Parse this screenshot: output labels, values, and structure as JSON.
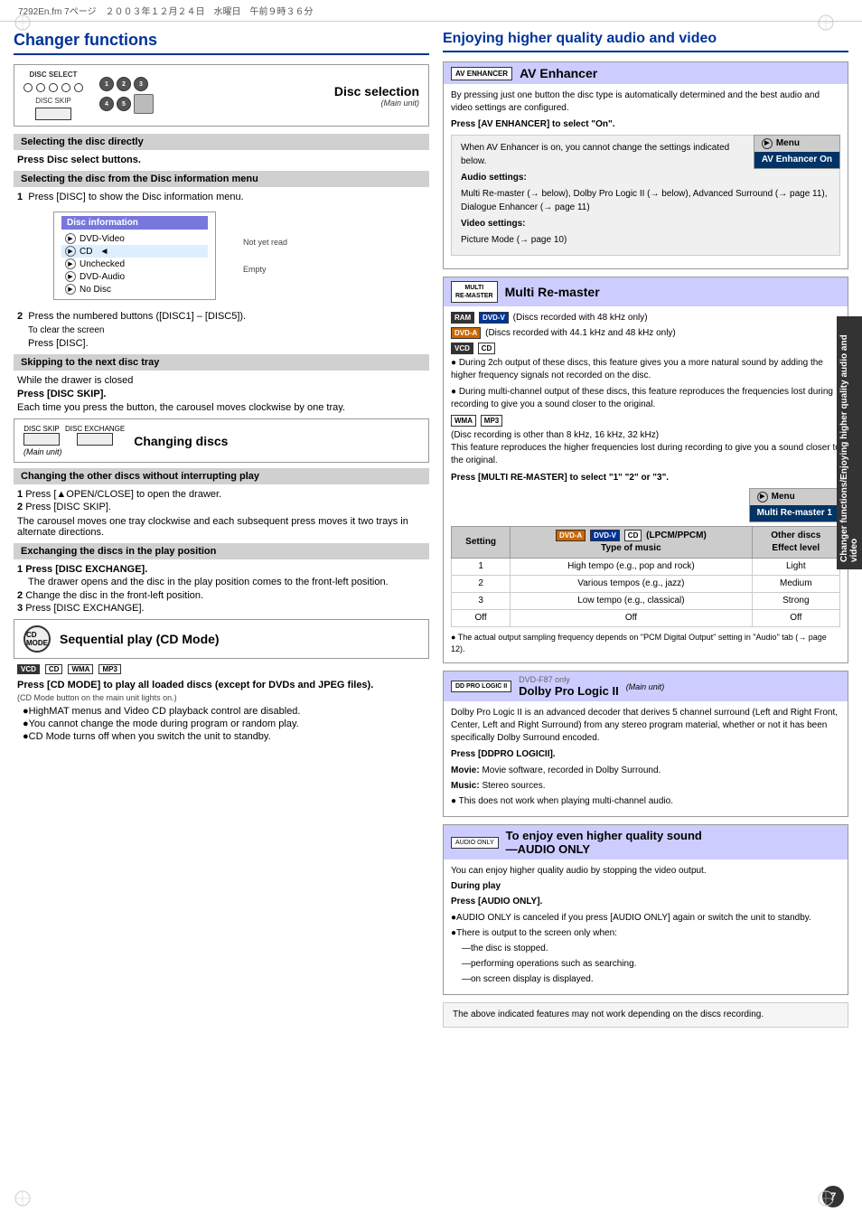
{
  "header": {
    "file_info": "7292En.fm 7ページ　２００３年１２月２４日　水曜日　午前９時３６分"
  },
  "left": {
    "section_title": "Changer functions",
    "disc_selection": {
      "title": "Disc selection",
      "main_unit": "(Main unit)",
      "disc_select_label": "DISC SELECT",
      "disc_skip_label": "DISC SKIP"
    },
    "selecting_disc_directly": {
      "header": "Selecting the disc directly",
      "instruction": "Press Disc select buttons."
    },
    "selecting_from_menu": {
      "header": "Selecting the disc from the Disc information menu",
      "step1": "Press [DISC] to show the Disc information menu.",
      "disc_info_title": "Disc information",
      "disc_items": [
        {
          "label": "DVD-Video",
          "note": ""
        },
        {
          "label": "CD",
          "note": ""
        },
        {
          "label": "Unchecked",
          "note": "Not yet read"
        },
        {
          "label": "DVD-Audio",
          "note": ""
        },
        {
          "label": "No Disc",
          "note": "Empty"
        }
      ],
      "step2": "Press the numbered buttons ([DISC1] – [DISC5]).",
      "clear_screen": "To clear the screen",
      "clear_press": "Press [DISC]."
    },
    "skipping_next": {
      "header": "Skipping to the next disc tray",
      "while_closed": "While the drawer is closed",
      "press": "Press [DISC SKIP].",
      "description": "Each time you press the button, the carousel moves clockwise by one tray."
    },
    "changing_discs": {
      "title": "Changing discs",
      "main_unit": "(Main unit)",
      "disc_skip_label": "DISC SKIP",
      "disc_exchange_label": "DISC EXCHANGE",
      "header": "Changing the other discs without interrupting play",
      "step1": "Press [▲OPEN/CLOSE] to open the drawer.",
      "step2": "Press [DISC SKIP].",
      "description": "The carousel moves one tray clockwise and each subsequent press moves it two trays in alternate directions."
    },
    "exchanging_discs": {
      "header": "Exchanging the discs in the play position",
      "step1_label": "Press [DISC EXCHANGE].",
      "step1_desc": "The drawer opens and the disc in the play position comes to the front-left position.",
      "step2": "Change the disc in the front-left position.",
      "step3": "Press [DISC EXCHANGE]."
    },
    "sequential_play": {
      "title": "Sequential play (CD Mode)",
      "badges": [
        "VCD",
        "CD",
        "WMA",
        "MP3"
      ],
      "press_instruction": "Press [CD MODE] to play all loaded discs (except for DVDs and JPEG files).",
      "note_cd": "(CD Mode button on the main unit lights on.)",
      "notes": [
        "HighMAT menus and Video CD playback control are disabled.",
        "You cannot change the mode during program or random play.",
        "CD Mode turns off when you switch the unit to standby."
      ]
    }
  },
  "right": {
    "section_title": "Enjoying higher quality audio and video",
    "av_enhancer": {
      "icon_label": "AV ENHANCER",
      "title": "AV Enhancer",
      "description": "By pressing just one button the disc type is automatically determined and the best audio and video settings are configured.",
      "press_instruction": "Press [AV ENHANCER] to select \"On\".",
      "menu_label": "Menu",
      "menu_on_label": "AV Enhancer On",
      "info_box": {
        "intro": "When AV Enhancer is on, you cannot change the settings indicated below.",
        "audio_settings_label": "Audio settings:",
        "audio_settings_text": "Multi Re-master (→ below), Dolby Pro Logic II (→ below), Advanced Surround (→ page 11), Dialogue Enhancer (→ page 11)",
        "video_settings_label": "Video settings:",
        "video_settings_text": "Picture Mode (→ page 10)"
      }
    },
    "multi_remaster": {
      "icon_label": "MULTI\nRE-MASTER",
      "title": "Multi Re-master",
      "badge_ram": "RAM",
      "badge_dvdv": "DVD-V",
      "badge_dvda": "DVD-A",
      "badge_vcd": "VCD",
      "badge_cd": "CD",
      "badge_wma": "WMA",
      "badge_mp3": "MP3",
      "disc_48khz": "(Discs recorded with 48 kHz only)",
      "disc_441khz": "(Discs recorded with 44.1 kHz and 48 kHz only)",
      "bullet1": "During 2ch output of these discs, this feature gives you a more natural sound by adding the higher frequency signals not recorded on the disc.",
      "bullet2": "During multi-channel output of these discs, this feature reproduces the frequencies lost during recording to give you a sound closer to the original.",
      "wma_mp3_note": "(Disc recording is other than 8 kHz, 16 kHz, 32 kHz)\nThis feature reproduces the higher frequencies lost during recording to give you a sound closer to the original.",
      "press_instruction": "Press [MULTI RE-MASTER] to select \"1\" \"2\" or \"3\".",
      "menu_label": "Menu",
      "menu_on_label": "Multi Re-master 1",
      "table": {
        "headers": [
          "Setting",
          "DVD-A  DVD-V  CD (LPCM/PPCM)\nType of music",
          "Other discs\nEffect level"
        ],
        "rows": [
          [
            "1",
            "High tempo (e.g., pop and rock)",
            "Light"
          ],
          [
            "2",
            "Various tempos (e.g., jazz)",
            "Medium"
          ],
          [
            "3",
            "Low tempo (e.g., classical)",
            "Strong"
          ],
          [
            "Off",
            "Off",
            "Off"
          ]
        ]
      },
      "footnote": "● The actual output sampling frequency depends on \"PCM Digital Output\" setting in \"Audio\" tab (→ page 12)."
    },
    "dolby_pro_logic": {
      "icon_label": "DD PRO LOGIC II",
      "dvd_only": "DVD-F87 only",
      "title": "Dolby Pro Logic II",
      "main_unit": "(Main unit)",
      "description": "Dolby Pro Logic II is an advanced decoder that derives 5 channel surround (Left and Right Front, Center, Left and Right Surround) from any stereo program material, whether or not it has been specifically Dolby Surround encoded.",
      "press_instruction": "Press [DDPRO LOGICII].",
      "movie_label": "Movie:",
      "movie_text": "Movie software, recorded in Dolby Surround.",
      "music_label": "Music:",
      "music_text": "Stereo sources.",
      "note": "● This does not work when playing multi-channel audio."
    },
    "audio_only": {
      "icon_label": "AUDIO ONLY",
      "title": "To enjoy even higher quality sound\n—AUDIO ONLY",
      "description": "You can enjoy higher quality audio by stopping the video output.",
      "during_play": "During play",
      "press_instruction": "Press [AUDIO ONLY].",
      "note1": "●AUDIO ONLY is canceled if you press [AUDIO ONLY] again or switch the unit to standby.",
      "note2": "●There is output to the screen only when:",
      "note2_subs": [
        "—the disc is stopped.",
        "—performing operations such as searching.",
        "—on screen display is displayed."
      ]
    },
    "footer_note": "The above indicated features may not work depending on the discs recording.",
    "page_number": "7",
    "side_text": "Changer functions/Enjoying higher quality audio and video"
  }
}
